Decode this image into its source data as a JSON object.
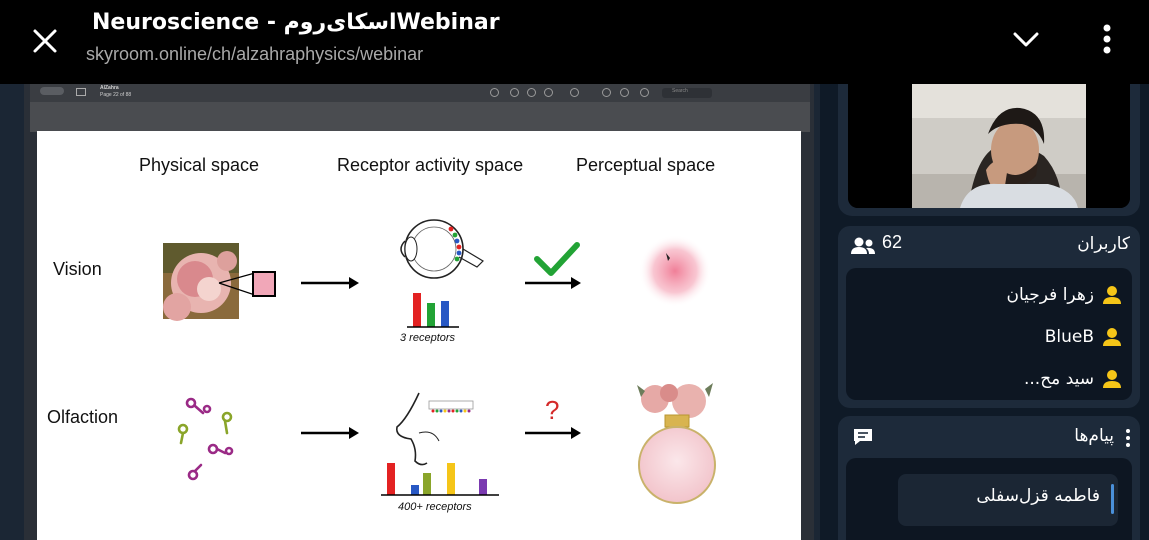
{
  "header": {
    "title": "Neuroscience - اسکای‌روم‌Webinar",
    "url": "skyroom.online/ch/alzahraphysics/webinar"
  },
  "pdf_viewer": {
    "doc_name": "AlZahra",
    "page_info": "Page 22 of 88",
    "search_placeholder": "Search"
  },
  "slide": {
    "headers": [
      "Physical space",
      "Receptor activity space",
      "Perceptual space"
    ],
    "rows": [
      "Vision",
      "Olfaction"
    ],
    "captions": [
      "3 receptors",
      "400+ receptors"
    ],
    "question_mark": "?"
  },
  "users": {
    "count": "62",
    "title": "کاربران",
    "items": [
      "زهرا فرجیان",
      "BlueB",
      "سید مح..."
    ]
  },
  "messages": {
    "title": "پیام‌ها",
    "items": [
      "فاطمه قزل‌سفلی"
    ]
  },
  "colors": {
    "topbar": "#000000",
    "card": "#1d2a3a",
    "user_icon": "#f5c518",
    "check": "#22a335",
    "question": "#d42a2a"
  }
}
